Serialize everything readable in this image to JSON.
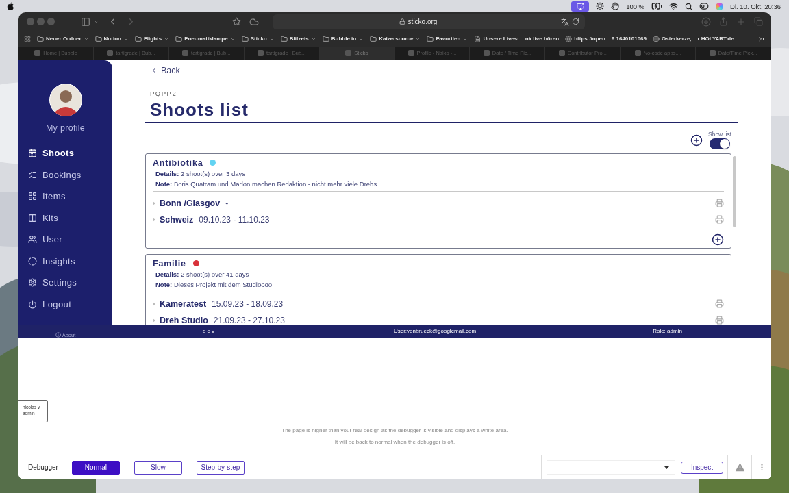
{
  "menu_bar": {
    "battery": "100 %",
    "clock": "Di. 10. Okt. 20:36"
  },
  "browser": {
    "address": "sticko.org",
    "bookmarks": [
      {
        "kind": "folder",
        "label": "Neuer Ordner"
      },
      {
        "kind": "folder",
        "label": "Notion"
      },
      {
        "kind": "folder",
        "label": "Flights"
      },
      {
        "kind": "folder",
        "label": "Pneumatiklampe"
      },
      {
        "kind": "folder",
        "label": "Sticko"
      },
      {
        "kind": "folder",
        "label": "Blitzeis"
      },
      {
        "kind": "folder",
        "label": "Bubble.io"
      },
      {
        "kind": "folder",
        "label": "Kaizersource"
      },
      {
        "kind": "folder",
        "label": "Favoriten"
      },
      {
        "kind": "page",
        "label": "Unsere Livest....nk live hören"
      },
      {
        "kind": "site",
        "label": "https://open....6.1640101069"
      },
      {
        "kind": "site",
        "label": "Osterkerze, ...r HOLYART.de"
      }
    ],
    "tabs": [
      {
        "title": "Home | Bubble",
        "selected": false
      },
      {
        "title": "tartigrade | Bub...",
        "selected": false
      },
      {
        "title": "tartigrade | Bub...",
        "selected": false
      },
      {
        "title": "tartigrade | Bub...",
        "selected": false
      },
      {
        "title": "Sticko",
        "selected": true
      },
      {
        "title": "Profile - Naiko -...",
        "selected": false
      },
      {
        "title": "Date / Time Pic...",
        "selected": false
      },
      {
        "title": "Contributor Pro...",
        "selected": false
      },
      {
        "title": "No-code apps,...",
        "selected": false
      },
      {
        "title": "Date/Time Pick...",
        "selected": false
      }
    ]
  },
  "sidebar": {
    "profile_label": "My profile",
    "items": [
      {
        "kind": "calendar",
        "label": "Shoots",
        "selected": true
      },
      {
        "kind": "checklist",
        "label": "Bookings",
        "selected": false
      },
      {
        "kind": "grid",
        "label": "Items",
        "selected": false
      },
      {
        "kind": "kit",
        "label": "Kits",
        "selected": false
      },
      {
        "kind": "users",
        "label": "User",
        "selected": false
      },
      {
        "kind": "ring",
        "label": "Insights",
        "selected": false
      },
      {
        "kind": "gear",
        "label": "Settings",
        "selected": false
      },
      {
        "kind": "power",
        "label": "Logout",
        "selected": false
      }
    ],
    "about": "About"
  },
  "page": {
    "back": "Back",
    "code": "PQPP2",
    "title": "Shoots list",
    "show_list": {
      "label": "Show list",
      "on": true
    },
    "projects": [
      {
        "name": "Antibiotika",
        "color": "#62d3f2",
        "details": "**Details:** 2 shoot(s) over 3 days",
        "note": "**Note:** Boris Quatram und Marlon machen Redaktion - nicht mehr viele Drehs",
        "shoots": [
          {
            "name": "Bonn /Glasgov",
            "dates": "-"
          },
          {
            "name": "Schweiz",
            "dates": "09.10.23 - 11.10.23"
          }
        ],
        "add_button": true
      },
      {
        "name": "Familie",
        "color": "#d8323a",
        "details": "**Details:** 2 shoot(s) over 41 days",
        "note": "**Note:** Dieses Projekt mit dem Studioooo",
        "shoots": [
          {
            "name": "Kameratest",
            "dates": "15.09.23 - 18.09.23"
          },
          {
            "name": "Dreh Studio",
            "dates": "21.09.23 - 27.10.23"
          }
        ],
        "add_button": false
      }
    ]
  },
  "status_bar": {
    "env": "dev",
    "user": "User:vonbrueck@googlemail.com",
    "role": "Role: admin"
  },
  "user_badge": {
    "name": "nicolas v.",
    "role": "admin"
  },
  "debugger_notice": [
    "The page is higher than your real design as the debugger is visible and displays a white area.",
    "It will be back to normal when the debugger is off."
  ],
  "debugger": {
    "label": "Debugger",
    "modes": [
      {
        "label": "Normal",
        "selected": true
      },
      {
        "label": "Slow",
        "selected": false
      },
      {
        "label": "Step-by-step",
        "selected": false
      }
    ],
    "inspect": "Inspect"
  }
}
